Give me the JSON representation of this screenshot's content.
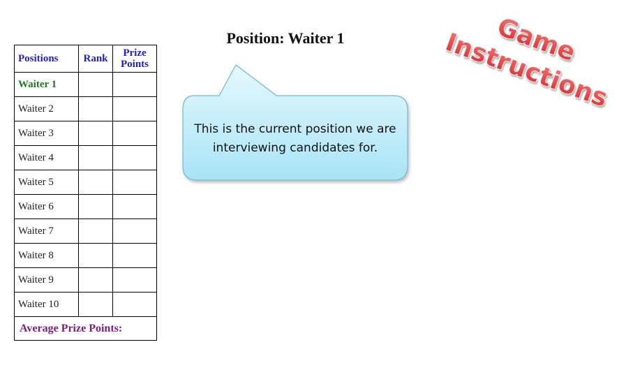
{
  "table": {
    "headers": {
      "positions": "Positions",
      "rank": "Rank",
      "prize_points": "Prize\nPoints"
    },
    "rows": [
      {
        "label": "Waiter 1",
        "rank": "",
        "prize": ""
      },
      {
        "label": "Waiter 2",
        "rank": "",
        "prize": ""
      },
      {
        "label": "Waiter 3",
        "rank": "",
        "prize": ""
      },
      {
        "label": "Waiter 4",
        "rank": "",
        "prize": ""
      },
      {
        "label": "Waiter 5",
        "rank": "",
        "prize": ""
      },
      {
        "label": "Waiter 6",
        "rank": "",
        "prize": ""
      },
      {
        "label": "Waiter 7",
        "rank": "",
        "prize": ""
      },
      {
        "label": "Waiter 8",
        "rank": "",
        "prize": ""
      },
      {
        "label": "Waiter 9",
        "rank": "",
        "prize": ""
      },
      {
        "label": "Waiter 10",
        "rank": "",
        "prize": ""
      }
    ],
    "average_label": "Average Prize Points:",
    "current_index": 0
  },
  "position_title": "Position: Waiter 1",
  "callout": {
    "text": "This is the current position we are interviewing candidates for."
  },
  "game_instructions": {
    "line1": "Game",
    "line2": "Instructions"
  },
  "colors": {
    "header_text": "#1f1fcf",
    "current_row_text": "#1f7a1f",
    "average_text": "#7a1f7a",
    "callout_fill_top": "#e6f8fd",
    "callout_fill_bottom": "#a8e4f6",
    "callout_border": "#6fb8cf",
    "game_text": "#e03a3a"
  }
}
